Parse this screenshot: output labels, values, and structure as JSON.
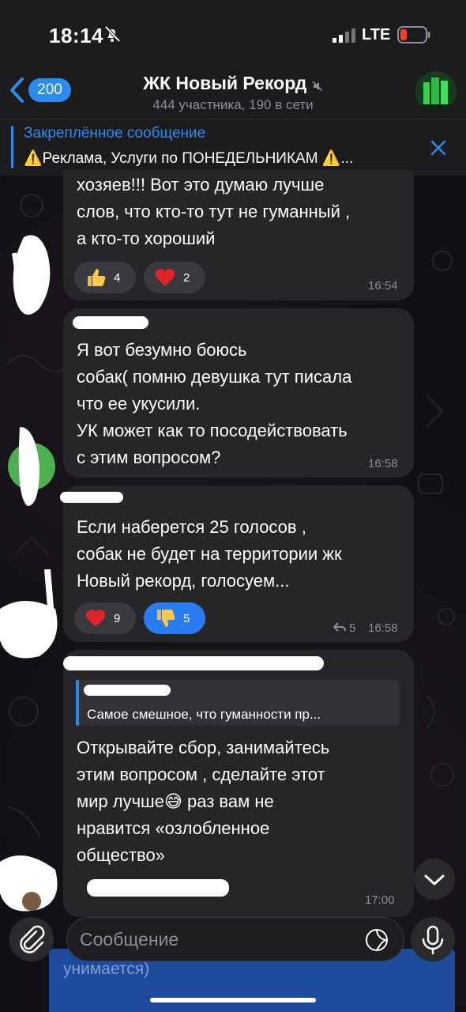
{
  "status_bar": {
    "time": "18:14",
    "network": "LTE"
  },
  "header": {
    "back_count": "200",
    "title": "ЖК Новый Рекорд",
    "subtitle": "444 участника, 190 в сети"
  },
  "pinned": {
    "title": "Закреплённое сообщение",
    "text": "⚠️Реклама, Услуги по ПОНЕДЕЛЬНИКАМ ⚠️..."
  },
  "messages": [
    {
      "text_lines": [
        "хозяев!!! Вот это думаю лучше",
        "слов, что кто-то тут не гуманный ,",
        "а кто-то хороший"
      ],
      "time": "16:54",
      "reactions": [
        {
          "emoji": "thumbs-up",
          "count": "4"
        },
        {
          "emoji": "heart",
          "count": "2"
        }
      ]
    },
    {
      "text_lines": [
        "Я вот безумно боюсь",
        "собак( помню девушка тут писала",
        "что ее укусили.",
        "УК может как то посодействовать",
        "с этим вопросом?"
      ],
      "time": "16:58"
    },
    {
      "text_lines": [
        "Если наберется 25 голосов ,",
        "собак не будет на территории жк",
        "Новый рекорд, голосуем..."
      ],
      "time": "16:58",
      "replies_count": "5",
      "reactions": [
        {
          "emoji": "heart",
          "count": "9"
        },
        {
          "emoji": "thumbs-down",
          "count": "5",
          "active": true
        }
      ]
    },
    {
      "reply_text": "Самое смешное, что гуманности пр...",
      "text_lines": [
        "Открывайте сбор, занимайтесь",
        "этим вопросом , сделайте этот",
        "мир лучше😅 раз вам не",
        "нравится «озлобленное",
        "общество»"
      ],
      "time": "17:00"
    }
  ],
  "input": {
    "placeholder": "Сообщение",
    "overlay_text": "унимается)"
  },
  "colors": {
    "accent": "#2a8cf0",
    "bubble": "#262528",
    "background": "#121015"
  }
}
